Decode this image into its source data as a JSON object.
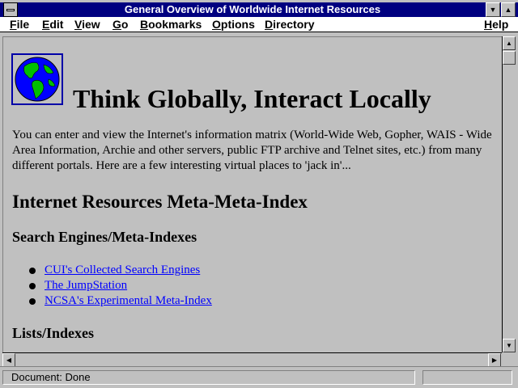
{
  "window": {
    "title": "General Overview of Worldwide Internet Resources"
  },
  "menubar": {
    "items": [
      {
        "label": "File",
        "accel": "F",
        "rest": "ile"
      },
      {
        "label": "Edit",
        "accel": "E",
        "rest": "dit"
      },
      {
        "label": "View",
        "accel": "V",
        "rest": "iew"
      },
      {
        "label": "Go",
        "accel": "G",
        "rest": "o"
      },
      {
        "label": "Bookmarks",
        "accel": "B",
        "rest": "ookmarks"
      },
      {
        "label": "Options",
        "accel": "O",
        "rest": "ptions"
      },
      {
        "label": "Directory",
        "accel": "D",
        "rest": "irectory"
      },
      {
        "label": "Help",
        "accel": "H",
        "rest": "elp"
      }
    ]
  },
  "page": {
    "heading": "Think Globally, Interact Locally",
    "intro": "You can enter and view the Internet's information matrix (World-Wide Web, Gopher, WAIS - Wide Area Information, Archie and other servers, public FTP archive and Telnet sites, etc.) from many different portals. Here are a few interesting virtual places to 'jack in'...",
    "section_title": "Internet Resources Meta-Meta-Index",
    "subsections": [
      {
        "title": "Search Engines/Meta-Indexes",
        "links": [
          "CUI's Collected Search Engines",
          "The JumpStation",
          "NCSA's Experimental Meta-Index"
        ]
      },
      {
        "title": "Lists/Indexes"
      }
    ]
  },
  "status": {
    "text": "Document: Done"
  },
  "colors": {
    "titlebar": "#000080",
    "link": "#0000ff",
    "globe_ocean": "#0000ff",
    "globe_land": "#00c000"
  },
  "icons": [
    "system-menu-icon",
    "minimize-icon",
    "maximize-icon",
    "globe-icon",
    "scroll-up-icon",
    "scroll-down-icon",
    "scroll-left-icon",
    "scroll-right-icon"
  ]
}
